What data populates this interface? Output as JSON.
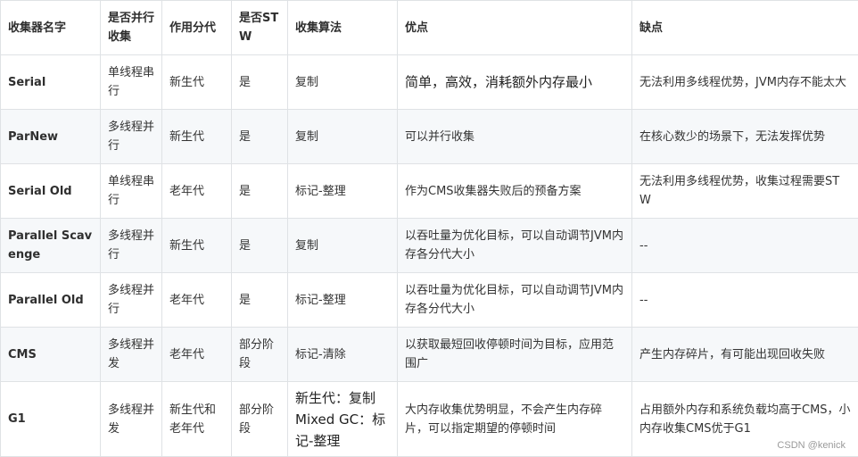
{
  "table": {
    "headers": [
      "收集器名字",
      "是否并行收集",
      "作用分代",
      "是否STW",
      "收集算法",
      "优点",
      "缺点"
    ],
    "rows": [
      {
        "name": "Serial",
        "parallel": "单线程串行",
        "generation": "新生代",
        "stw": "是",
        "algorithm": "复制",
        "pros": "简单，高效，消耗额外内存最小",
        "cons": "无法利用多线程优势，JVM内存不能太大"
      },
      {
        "name": "ParNew",
        "parallel": "多线程并行",
        "generation": "新生代",
        "stw": "是",
        "algorithm": "复制",
        "pros": "可以并行收集",
        "cons": "在核心数少的场景下，无法发挥优势"
      },
      {
        "name": "Serial Old",
        "parallel": "单线程串行",
        "generation": "老年代",
        "stw": "是",
        "algorithm": "标记-整理",
        "pros": "作为CMS收集器失败后的预备方案",
        "cons": "无法利用多线程优势，收集过程需要STW"
      },
      {
        "name": "Parallel Scavenge",
        "parallel": "多线程并行",
        "generation": "新生代",
        "stw": "是",
        "algorithm": "复制",
        "pros": "以吞吐量为优化目标，可以自动调节JVM内存各分代大小",
        "cons": "--"
      },
      {
        "name": "Parallel Old",
        "parallel": "多线程并行",
        "generation": "老年代",
        "stw": "是",
        "algorithm": "标记-整理",
        "pros": "以吞吐量为优化目标，可以自动调节JVM内存各分代大小",
        "cons": "--"
      },
      {
        "name": "CMS",
        "parallel": "多线程并发",
        "generation": "老年代",
        "stw": "部分阶段",
        "algorithm": "标记-清除",
        "pros": "以获取最短回收停顿时间为目标，应用范围广",
        "cons": "产生内存碎片，有可能出现回收失败"
      },
      {
        "name": "G1",
        "parallel": "多线程并发",
        "generation": "新生代和老年代",
        "stw": "部分阶段",
        "algorithm": "新生代：复制 Mixed GC：标记-整理",
        "pros": "大内存收集优势明显，不会产生内存碎片，可以指定期望的停顿时间",
        "cons": "占用额外内存和系统负载均高于CMS，小内存收集CMS优于G1"
      }
    ]
  },
  "watermark": "CSDN @kenick"
}
